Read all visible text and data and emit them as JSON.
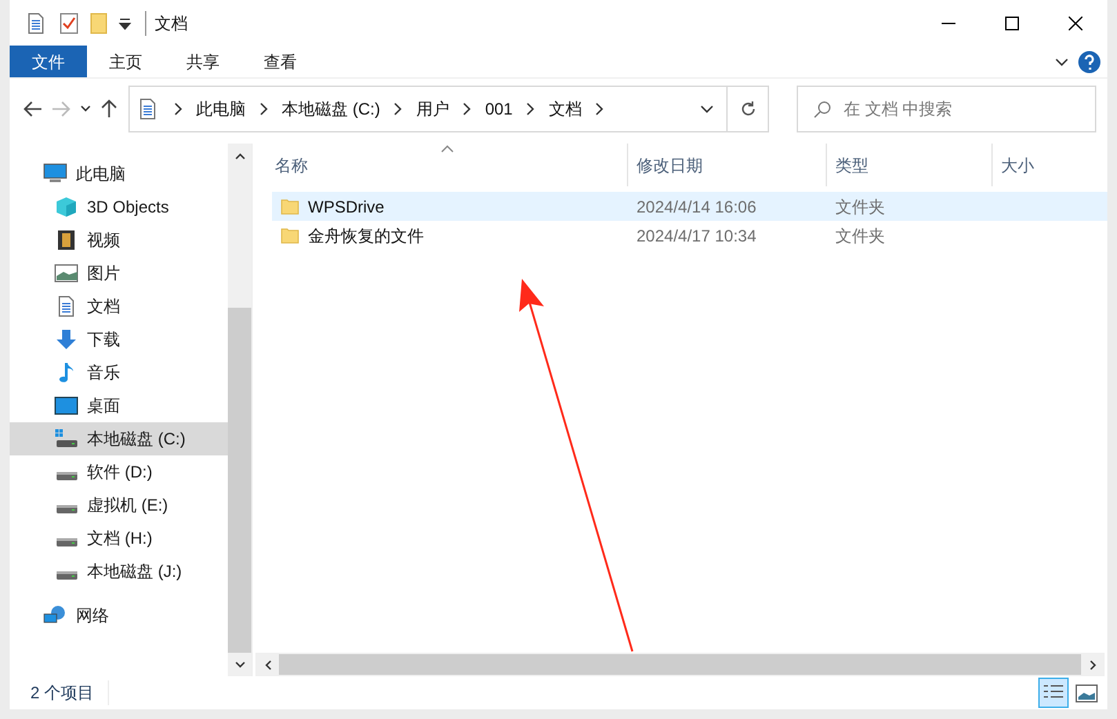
{
  "window": {
    "title": "文档"
  },
  "ribbon_tabs": [
    {
      "label": "文件",
      "selected": true
    },
    {
      "label": "主页",
      "selected": false
    },
    {
      "label": "共享",
      "selected": false
    },
    {
      "label": "查看",
      "selected": false
    }
  ],
  "breadcrumb": [
    "此电脑",
    "本地磁盘 (C:)",
    "用户",
    "001",
    "文档"
  ],
  "search": {
    "placeholder": "在 文档 中搜索"
  },
  "sidebar": {
    "items": [
      {
        "label": "此电脑",
        "kind": "pc",
        "selected": false,
        "children": [
          {
            "label": "3D Objects",
            "kind": "cube",
            "selected": false
          },
          {
            "label": "视频",
            "kind": "video",
            "selected": false
          },
          {
            "label": "图片",
            "kind": "pictures",
            "selected": false
          },
          {
            "label": "文档",
            "kind": "document",
            "selected": false
          },
          {
            "label": "下载",
            "kind": "download",
            "selected": false
          },
          {
            "label": "音乐",
            "kind": "music",
            "selected": false
          },
          {
            "label": "桌面",
            "kind": "desktop",
            "selected": false
          },
          {
            "label": "本地磁盘 (C:)",
            "kind": "system-drive",
            "selected": true
          },
          {
            "label": "软件 (D:)",
            "kind": "drive",
            "selected": false
          },
          {
            "label": "虚拟机 (E:)",
            "kind": "drive",
            "selected": false
          },
          {
            "label": "文档 (H:)",
            "kind": "drive",
            "selected": false
          },
          {
            "label": "本地磁盘 (J:)",
            "kind": "drive",
            "selected": false
          }
        ]
      },
      {
        "label": "网络",
        "kind": "network",
        "selected": false
      }
    ]
  },
  "table": {
    "columns": [
      "名称",
      "修改日期",
      "类型",
      "大小"
    ],
    "rows": [
      {
        "name": "WPSDrive",
        "date": "2024/4/14 16:06",
        "type": "文件夹",
        "selected": true
      },
      {
        "name": "金舟恢复的文件",
        "date": "2024/4/17 10:34",
        "type": "文件夹",
        "selected": false
      }
    ]
  },
  "status_bar": {
    "count": "2 个项目"
  },
  "view_buttons": [
    {
      "kind": "details",
      "selected": true
    },
    {
      "kind": "tiles",
      "selected": false
    }
  ]
}
